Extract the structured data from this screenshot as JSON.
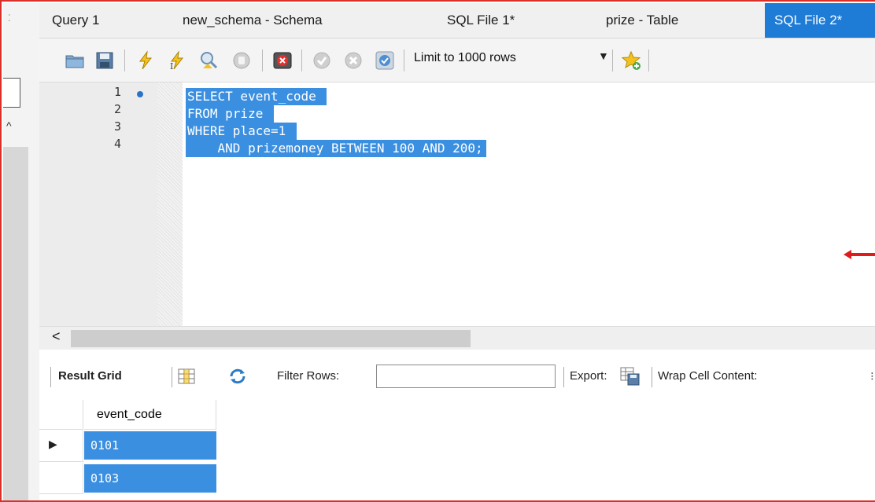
{
  "tabs": [
    {
      "label": "Query 1"
    },
    {
      "label": "new_schema - Schema"
    },
    {
      "label": "SQL File 1*"
    },
    {
      "label": "prize - Table"
    },
    {
      "label": "SQL File 2*"
    }
  ],
  "toolbar": {
    "limit_label": "Limit to 1000 rows"
  },
  "editor": {
    "line_numbers": [
      "1",
      "2",
      "3",
      "4"
    ],
    "lines": [
      "SELECT event_code ",
      "FROM prize ",
      "WHERE place=1 ",
      "    AND prizemoney BETWEEN 100 AND 200;"
    ]
  },
  "results_toolbar": {
    "result_grid_label": "Result Grid",
    "filter_label": "Filter Rows:",
    "filter_value": "",
    "export_label": "Export:",
    "wrap_label": "Wrap Cell Content:"
  },
  "result_grid": {
    "columns": [
      "event_code"
    ],
    "rows": [
      [
        "0101"
      ],
      [
        "0103"
      ]
    ]
  },
  "colors": {
    "active_tab": "#1e7bd6",
    "selection": "#3b8fe0",
    "annotation_arrow": "#e01b1b"
  }
}
